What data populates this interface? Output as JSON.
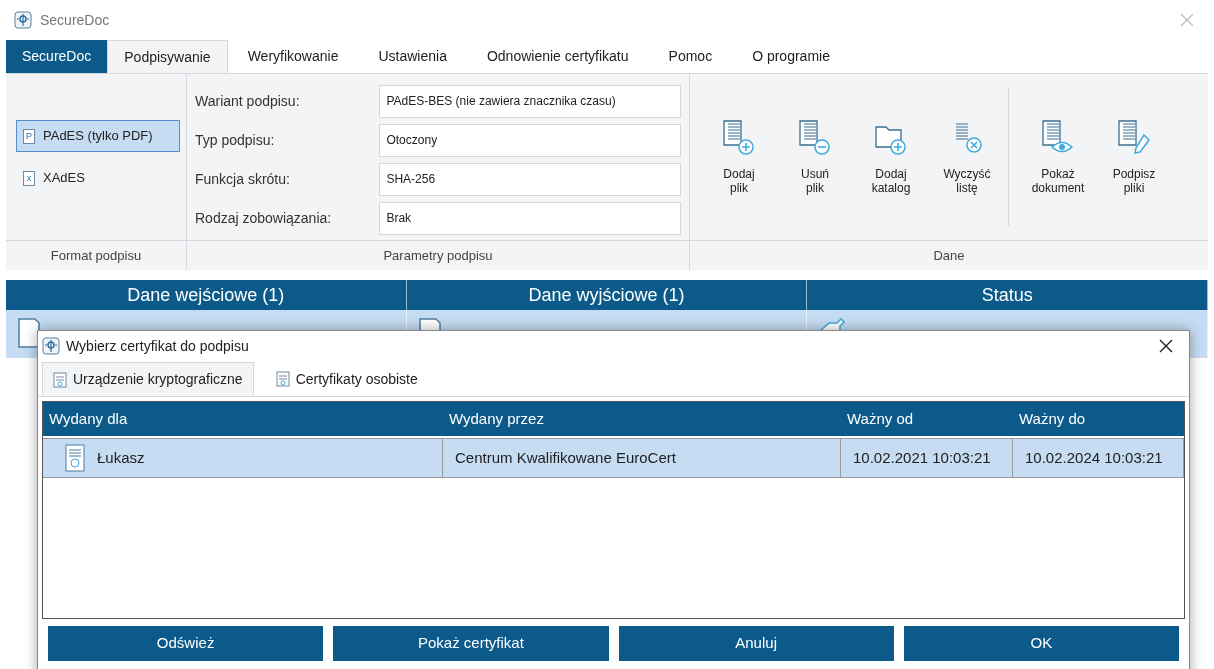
{
  "window": {
    "title": "SecureDoc"
  },
  "tabs": [
    {
      "label": "SecureDoc",
      "kind": "app"
    },
    {
      "label": "Podpisywanie",
      "selected": true
    },
    {
      "label": "Weryfikowanie",
      "selected": false
    },
    {
      "label": "Ustawienia",
      "selected": false
    },
    {
      "label": "Odnowienie certyfikatu",
      "selected": false
    },
    {
      "label": "Pomoc",
      "selected": false
    },
    {
      "label": "O programie",
      "selected": false
    }
  ],
  "format_group": {
    "label": "Format podpisu",
    "options": [
      {
        "label": "PAdES (tylko PDF)",
        "icon": "P",
        "selected": true
      },
      {
        "label": "XAdES",
        "icon": "x",
        "selected": false
      }
    ]
  },
  "params_group": {
    "label": "Parametry podpisu",
    "fields": [
      {
        "label": "Wariant podpisu:",
        "value": "PAdES-BES (nie zawiera znacznika czasu)"
      },
      {
        "label": "Typ podpisu:",
        "value": "Otoczony"
      },
      {
        "label": "Funkcja skrótu:",
        "value": "SHA-256"
      },
      {
        "label": "Rodzaj zobowiązania:",
        "value": "Brak"
      }
    ]
  },
  "data_group": {
    "label": "Dane",
    "buttons": [
      [
        {
          "label": "Dodaj\nplik",
          "kind": "add-file"
        },
        {
          "label": "Usuń\nplik",
          "kind": "remove-file"
        },
        {
          "label": "Dodaj\nkatalog",
          "kind": "add-folder"
        },
        {
          "label": "Wyczyść\nlistę",
          "kind": "clear-list"
        }
      ],
      [
        {
          "label": "Pokaż\ndokument",
          "kind": "show-doc"
        },
        {
          "label": "Podpisz\npliki",
          "kind": "sign"
        }
      ]
    ]
  },
  "files_table": {
    "columns": [
      "Dane wejściowe (1)",
      "Dane wyjściowe (1)",
      "Status"
    ]
  },
  "dialog": {
    "title": "Wybierz certyfikat do podpisu",
    "tabs": [
      {
        "label": "Urządzenie kryptograficzne",
        "selected": true
      },
      {
        "label": "Certyfikaty osobiste",
        "selected": false
      }
    ],
    "table": {
      "columns": [
        "Wydany dla",
        "Wydany przez",
        "Ważny od",
        "Ważny do"
      ],
      "rows": [
        {
          "cells": [
            "Łukasz",
            "Centrum Kwalifikowane EuroCert",
            "10.02.2021 10:03:21",
            "10.02.2024 10:03:21"
          ],
          "selected": true
        }
      ]
    },
    "buttons": [
      "Odśwież",
      "Pokaż certyfikat",
      "Anuluj",
      "OK"
    ]
  }
}
